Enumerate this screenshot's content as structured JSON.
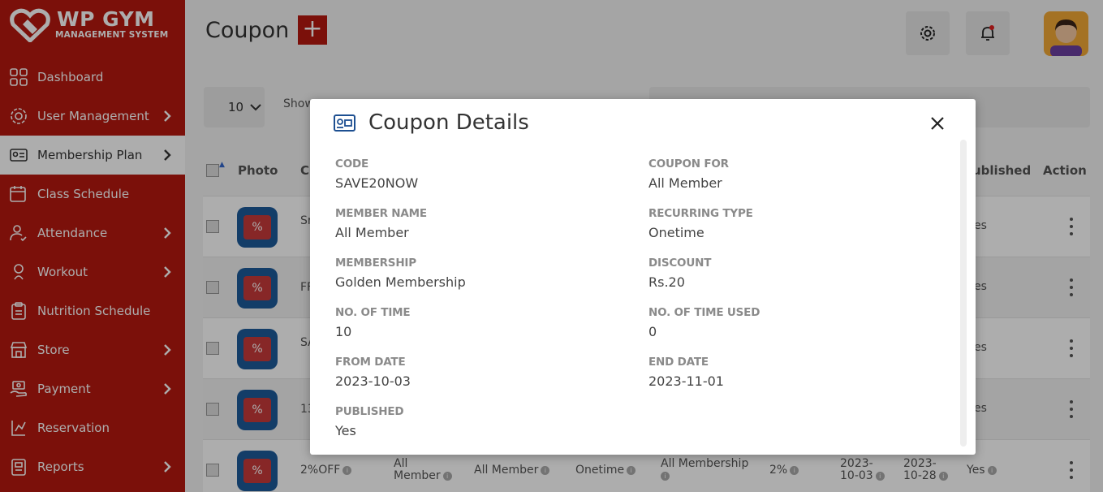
{
  "app": {
    "brand": "WP GYM",
    "brand_sub": "MANAGEMENT SYSTEM"
  },
  "sidebar": {
    "items": [
      {
        "label": "Dashboard",
        "icon": "dashboard-icon"
      },
      {
        "label": "User Management",
        "icon": "gear-users-icon"
      },
      {
        "label": "Membership Plan",
        "icon": "membership-card-icon"
      },
      {
        "label": "Class Schedule",
        "icon": "calendar-icon"
      },
      {
        "label": "Attendance",
        "icon": "user-check-icon"
      },
      {
        "label": "Workout",
        "icon": "dumbbell-icon"
      },
      {
        "label": "Nutrition Schedule",
        "icon": "clipboard-icon"
      },
      {
        "label": "Store",
        "icon": "store-icon"
      },
      {
        "label": "Payment",
        "icon": "payment-icon"
      },
      {
        "label": "Reservation",
        "icon": "reservation-icon"
      },
      {
        "label": "Reports",
        "icon": "report-icon"
      }
    ]
  },
  "header": {
    "title": "Coupon",
    "add_label": "+"
  },
  "table": {
    "length_value": "10",
    "show_text": "Show",
    "columns": {
      "photo": "Photo",
      "code": "C",
      "published": "ublished",
      "action": "Action"
    },
    "rows": [
      {
        "code": "Sr",
        "pub": "es"
      },
      {
        "code": "FF",
        "pub": "es"
      },
      {
        "code": "SA",
        "pub": "es"
      },
      {
        "code": "13",
        "pub": "es"
      },
      {
        "code": "2%OFF",
        "coupon_for_1": "All",
        "coupon_for_2": "Member",
        "member_name": "All Member",
        "recurring": "Onetime",
        "membership": "All Membership",
        "discount": "2%",
        "from_1": "2023-",
        "from_2": "10-03",
        "end_1": "2023-",
        "end_2": "10-28",
        "pub": "Yes"
      }
    ]
  },
  "modal": {
    "title": "Coupon Details",
    "fields": {
      "code": {
        "label": "CODE",
        "value": "SAVE20NOW"
      },
      "coupon_for": {
        "label": "COUPON FOR",
        "value": "All Member"
      },
      "member_name": {
        "label": "MEMBER NAME",
        "value": "All Member"
      },
      "recurring_type": {
        "label": "RECURRING TYPE",
        "value": "Onetime"
      },
      "membership": {
        "label": "MEMBERSHIP",
        "value": "Golden Membership"
      },
      "discount": {
        "label": "DISCOUNT",
        "value": "Rs.20"
      },
      "no_of_time": {
        "label": "NO. OF TIME",
        "value": "10"
      },
      "no_of_time_used": {
        "label": "NO. OF TIME USED",
        "value": "0"
      },
      "from_date": {
        "label": "FROM DATE",
        "value": "2023-10-03"
      },
      "end_date": {
        "label": "END DATE",
        "value": "2023-11-01"
      },
      "published": {
        "label": "PUBLISHED",
        "value": "Yes"
      }
    }
  },
  "colors": {
    "brand_red": "#b5190f",
    "overlay": "rgba(0,0,0,0.32)"
  }
}
